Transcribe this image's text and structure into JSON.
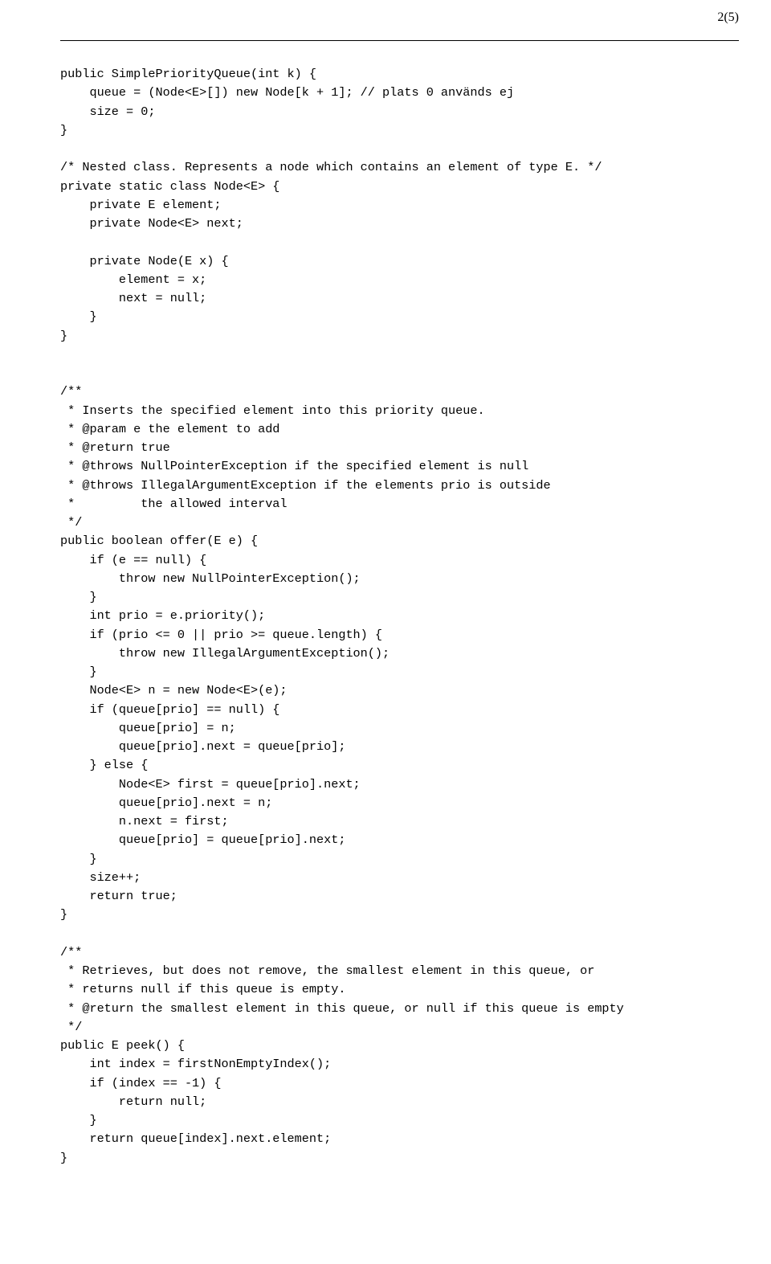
{
  "page_label": "2(5)",
  "code": "public SimplePriorityQueue(int k) {\n    queue = (Node<E>[]) new Node[k + 1]; // plats 0 används ej\n    size = 0;\n}\n\n/* Nested class. Represents a node which contains an element of type E. */\nprivate static class Node<E> {\n    private E element;\n    private Node<E> next;\n\n    private Node(E x) {\n        element = x;\n        next = null;\n    }\n}\n\n\n/**\n * Inserts the specified element into this priority queue.\n * @param e the element to add\n * @return true\n * @throws NullPointerException if the specified element is null\n * @throws IllegalArgumentException if the elements prio is outside\n *         the allowed interval\n */\npublic boolean offer(E e) {\n    if (e == null) {\n        throw new NullPointerException();\n    }\n    int prio = e.priority();\n    if (prio <= 0 || prio >= queue.length) {\n        throw new IllegalArgumentException();\n    }\n    Node<E> n = new Node<E>(e);\n    if (queue[prio] == null) {\n        queue[prio] = n;\n        queue[prio].next = queue[prio];\n    } else {\n        Node<E> first = queue[prio].next;\n        queue[prio].next = n;\n        n.next = first;\n        queue[prio] = queue[prio].next;\n    }\n    size++;\n    return true;\n}\n\n/**\n * Retrieves, but does not remove, the smallest element in this queue, or\n * returns null if this queue is empty.\n * @return the smallest element in this queue, or null if this queue is empty\n */\npublic E peek() {\n    int index = firstNonEmptyIndex();\n    if (index == -1) {\n        return null;\n    }\n    return queue[index].next.element;\n}"
}
